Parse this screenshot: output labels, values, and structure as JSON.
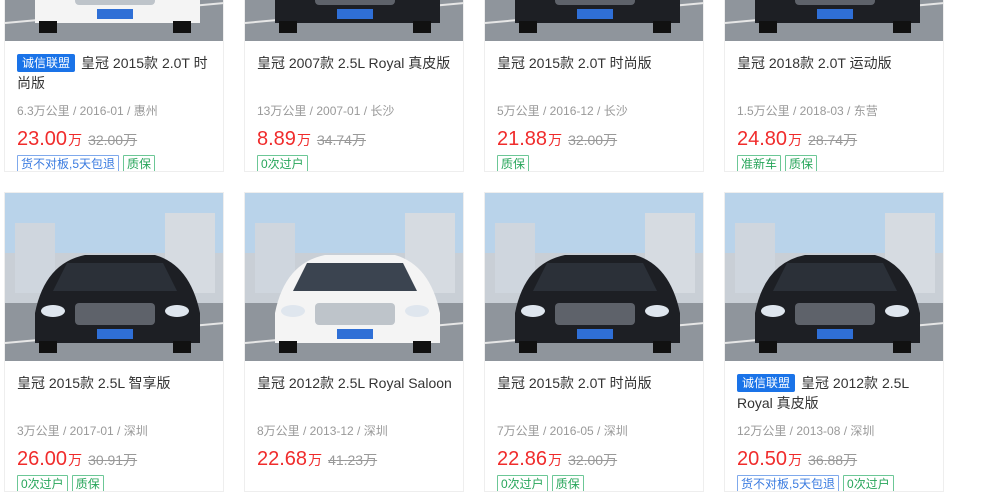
{
  "rows": [
    {
      "cards": [
        {
          "badge": "诚信联盟",
          "title": "皇冠 2015款 2.0T 时尚版",
          "meta": "6.3万公里 / 2016-01 / 惠州",
          "price": "23.00",
          "unit": "万",
          "original_price": "32.00万",
          "tags": [
            {
              "text": "货不对板,5天包退",
              "style": "blue"
            },
            {
              "text": "质保",
              "style": "green"
            }
          ],
          "car_color": "white"
        },
        {
          "badge": "",
          "title": "皇冠 2007款 2.5L Royal 真皮版",
          "meta": "13万公里 / 2007-01 / 长沙",
          "price": "8.89",
          "unit": "万",
          "original_price": "34.74万",
          "tags": [
            {
              "text": "0次过户",
              "style": "green"
            }
          ],
          "car_color": "black"
        },
        {
          "badge": "",
          "title": "皇冠 2015款 2.0T 时尚版",
          "meta": "5万公里 / 2016-12 / 长沙",
          "price": "21.88",
          "unit": "万",
          "original_price": "32.00万",
          "tags": [
            {
              "text": "质保",
              "style": "green"
            }
          ],
          "car_color": "black"
        },
        {
          "badge": "",
          "title": "皇冠 2018款 2.0T 运动版",
          "meta": "1.5万公里 / 2018-03 / 东营",
          "price": "24.80",
          "unit": "万",
          "original_price": "28.74万",
          "tags": [
            {
              "text": "准新车",
              "style": "green"
            },
            {
              "text": "质保",
              "style": "green"
            }
          ],
          "car_color": "black"
        }
      ]
    },
    {
      "cards": [
        {
          "badge": "",
          "title": "皇冠 2015款 2.5L 智享版",
          "meta": "3万公里 / 2017-01 / 深圳",
          "price": "26.00",
          "unit": "万",
          "original_price": "30.91万",
          "tags": [
            {
              "text": "0次过户",
              "style": "green"
            },
            {
              "text": "质保",
              "style": "green"
            }
          ],
          "car_color": "black"
        },
        {
          "badge": "",
          "title": "皇冠 2012款 2.5L Royal Saloon",
          "meta": "8万公里 / 2013-12 / 深圳",
          "price": "22.68",
          "unit": "万",
          "original_price": "41.23万",
          "tags": [],
          "car_color": "white"
        },
        {
          "badge": "",
          "title": "皇冠 2015款 2.0T 时尚版",
          "meta": "7万公里 / 2016-05 / 深圳",
          "price": "22.86",
          "unit": "万",
          "original_price": "32.00万",
          "tags": [
            {
              "text": "0次过户",
              "style": "green"
            },
            {
              "text": "质保",
              "style": "green"
            }
          ],
          "car_color": "black"
        },
        {
          "badge": "诚信联盟",
          "title": "皇冠 2012款 2.5L Royal 真皮版",
          "meta": "12万公里 / 2013-08 / 深圳",
          "price": "20.50",
          "unit": "万",
          "original_price": "36.88万",
          "tags": [
            {
              "text": "货不对板,5天包退",
              "style": "blue"
            },
            {
              "text": "0次过户",
              "style": "green"
            }
          ],
          "car_color": "black"
        }
      ]
    }
  ]
}
